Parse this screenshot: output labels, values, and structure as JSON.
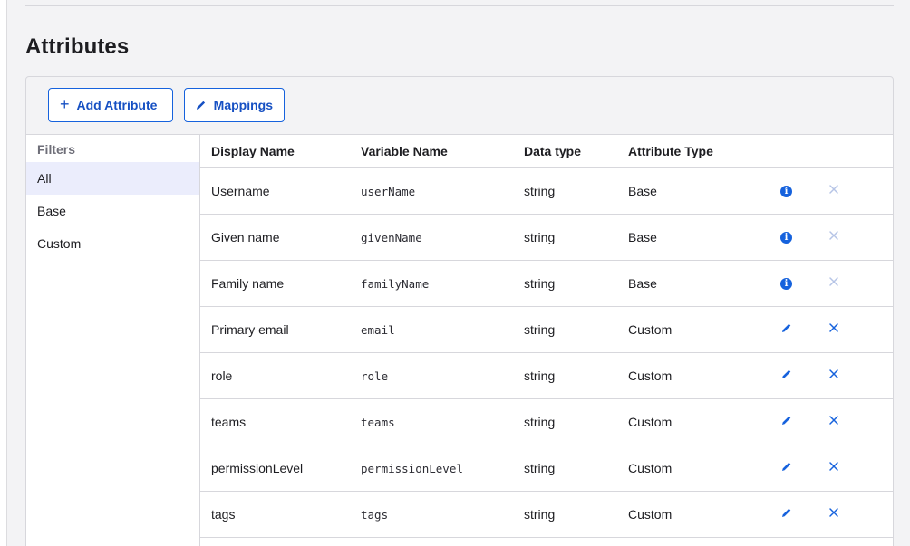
{
  "page": {
    "title": "Attributes"
  },
  "toolbar": {
    "add_label": "Add Attribute",
    "mappings_label": "Mappings"
  },
  "filters": {
    "heading": "Filters",
    "items": [
      {
        "label": "All",
        "active": true
      },
      {
        "label": "Base"
      },
      {
        "label": "Custom"
      }
    ]
  },
  "table": {
    "columns": [
      "Display Name",
      "Variable Name",
      "Data type",
      "Attribute Type"
    ],
    "rows": [
      {
        "display": "Username",
        "variable": "userName",
        "type": "string",
        "attr": "Base",
        "action": "info",
        "delete_enabled": false
      },
      {
        "display": "Given name",
        "variable": "givenName",
        "type": "string",
        "attr": "Base",
        "action": "info",
        "delete_enabled": false
      },
      {
        "display": "Family name",
        "variable": "familyName",
        "type": "string",
        "attr": "Base",
        "action": "info",
        "delete_enabled": false
      },
      {
        "display": "Primary email",
        "variable": "email",
        "type": "string",
        "attr": "Custom",
        "action": "edit",
        "delete_enabled": true
      },
      {
        "display": "role",
        "variable": "role",
        "type": "string",
        "attr": "Custom",
        "action": "edit",
        "delete_enabled": true
      },
      {
        "display": "teams",
        "variable": "teams",
        "type": "string",
        "attr": "Custom",
        "action": "edit",
        "delete_enabled": true
      },
      {
        "display": "permissionLevel",
        "variable": "permissionLevel",
        "type": "string",
        "attr": "Custom",
        "action": "edit",
        "delete_enabled": true
      },
      {
        "display": "tags",
        "variable": "tags",
        "type": "string",
        "attr": "Custom",
        "action": "edit",
        "delete_enabled": true
      }
    ]
  },
  "icons": {
    "add": "plus-icon",
    "mappings": "pencil-icon",
    "info": "info-icon",
    "edit": "pencil-icon",
    "delete": "close-icon"
  },
  "colors": {
    "accent": "#1662dd",
    "accent_text": "#1650c3",
    "disabled_icon": "#b6c4e6",
    "active_filter_bg": "#ebedfc"
  }
}
